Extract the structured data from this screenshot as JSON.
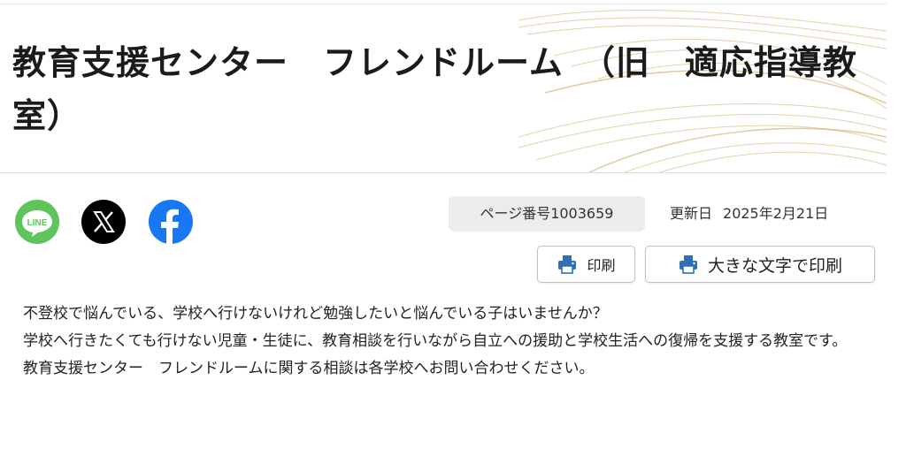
{
  "page": {
    "title": "教育支援センター　フレンドルーム　（旧　適応指導教室）",
    "page_number": "ページ番号1003659",
    "updated_label": "更新日",
    "updated_date": "2025年2月21日"
  },
  "share": [
    {
      "name": "line-share",
      "label": "LINE",
      "icon": "line-icon",
      "color": "#5ec55d"
    },
    {
      "name": "x-share",
      "label": "X",
      "icon": "x-icon",
      "color": "#000000"
    },
    {
      "name": "facebook-share",
      "label": "f",
      "icon": "facebook-icon",
      "color": "#1877f2"
    }
  ],
  "toolbar": {
    "print_label": "印刷",
    "print_large_label": "大きな文字で印刷",
    "icon": "printer-icon",
    "accent": "#2f6fb7"
  },
  "content": {
    "paragraphs": [
      "不登校で悩んでいる、学校へ行けないけれど勉強したいと悩んでいる子はいませんか？",
      "学校へ行きたくても行けない児童・生徒に、教育相談を行いながら自立への援助と学校生活への復帰を支援する教室です。",
      "教育支援センター　フレンドルームに関する相談は各学校へお問い合わせください。"
    ]
  },
  "theme": {
    "header_deco": "#d9c58f"
  }
}
